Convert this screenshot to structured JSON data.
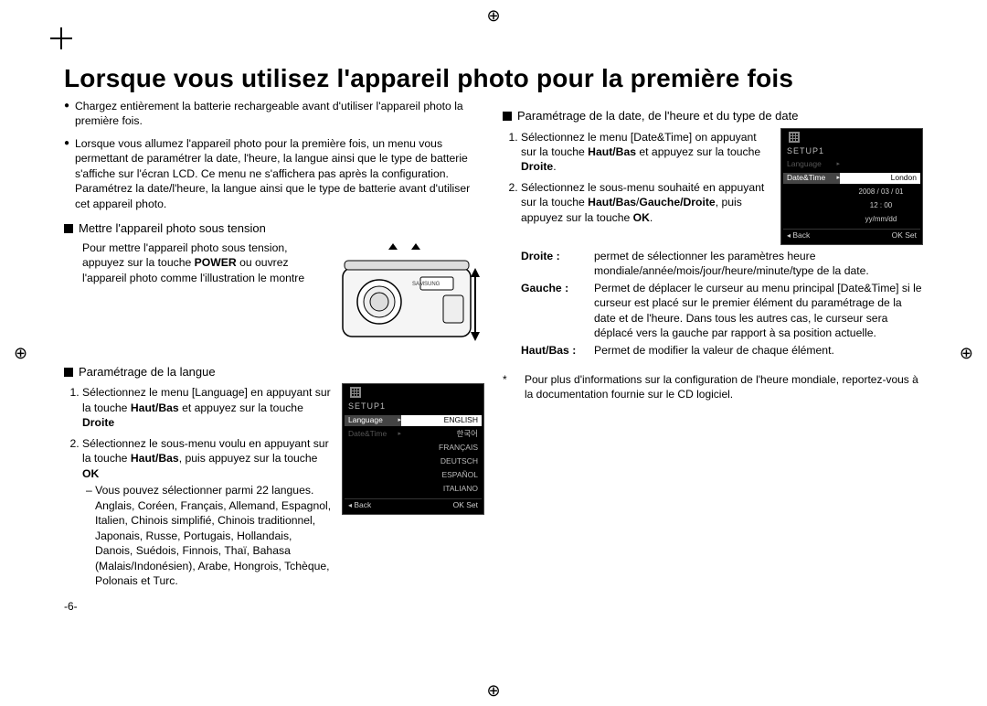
{
  "title": "Lorsque vous utilisez l'appareil photo pour la première fois",
  "page_number": "-6-",
  "left": {
    "bullet1": "Chargez entièrement la batterie rechargeable avant d'utiliser l'appareil photo la première fois.",
    "bullet2": "Lorsque vous allumez l'appareil photo pour la première fois, un menu vous permettant de paramétrer la date, l'heure, la langue ainsi que le type de batterie s'affiche sur l'écran LCD. Ce menu ne s'affichera pas après la configuration. Paramétrez la date/l'heure, la langue ainsi que le type de batterie avant d'utiliser cet appareil photo.",
    "sec1": {
      "head": "Mettre l'appareil photo sous tension",
      "body_pre": "Pour mettre l'appareil photo sous tension, appuyez sur la touche ",
      "power": "POWER",
      "body_post": " ou ouvrez l'appareil photo comme l'illustration le montre"
    },
    "sec2": {
      "head": "Paramétrage de la langue",
      "step1_a": "Sélectionnez le menu [Language] en appuyant sur la touche ",
      "hb": "Haut/Bas",
      "step1_b": " et appuyez sur la touche ",
      "dr": "Droite",
      "step2_a": "Sélectionnez le sous-menu voulu en appuyant sur la touche ",
      "step2_b": ", puis appuyez sur la touche ",
      "ok": "OK",
      "sub": "Vous pouvez sélectionner parmi 22 langues. Anglais, Coréen, Français, Allemand, Espagnol, Italien, Chinois simplifié, Chinois traditionnel, Japonais, Russe, Portugais, Hollandais, Danois, Suédois, Finnois, Thaï, Bahasa (Malais/Indonésien), Arabe, Hongrois, Tchèque, Polonais et Turc."
    },
    "lcd": {
      "setup": "SETUP1",
      "language": "Language",
      "datetime": "Date&Time",
      "opts": [
        "ENGLISH",
        "한국어",
        "FRANÇAIS",
        "DEUTSCH",
        "ESPAÑOL",
        "ITALIANO"
      ],
      "back": "Back",
      "okset": "OK  Set"
    }
  },
  "right": {
    "sec": {
      "head": "Paramétrage de la date, de l'heure et du type de date",
      "step1_a": "Sélectionnez le menu [Date&Time] on appuyant sur la touche ",
      "hb": "Haut/Bas",
      "step1_b": " et appuyez sur la touche ",
      "dr": "Droite",
      "step2_a": "Sélectionnez le sous-menu souhaité en appuyant sur la touche ",
      "hb2": "Haut/Bas",
      "gd": "Gauche/Droite",
      "step2_b": ", puis appuyez sur la touche ",
      "ok": "OK",
      "defs": {
        "droite_l": "Droite :",
        "droite_t": "permet de sélectionner les paramètres heure mondiale/année/mois/jour/heure/minute/type de la date.",
        "gauche_l": "Gauche :",
        "gauche_t": "Permet de déplacer le curseur au menu principal [Date&Time] si le curseur est placé sur le premier élément du paramétrage de la date et de l'heure. Dans tous les autres cas, le curseur sera déplacé vers la gauche par rapport à sa position actuelle.",
        "hb_l": "Haut/Bas :",
        "hb_t": "Permet de modifier la valeur de chaque élément."
      }
    },
    "lcd": {
      "setup": "SETUP1",
      "language": "Language",
      "datetime": "Date&Time",
      "london": "London",
      "date": "2008 / 03 / 01",
      "time": "12 : 00",
      "fmt": "yy/mm/dd",
      "back": "Back",
      "okset": "OK  Set"
    },
    "note": "Pour plus d'informations sur la configuration de l'heure mondiale, reportez-vous à la documentation fournie sur le CD logiciel."
  }
}
